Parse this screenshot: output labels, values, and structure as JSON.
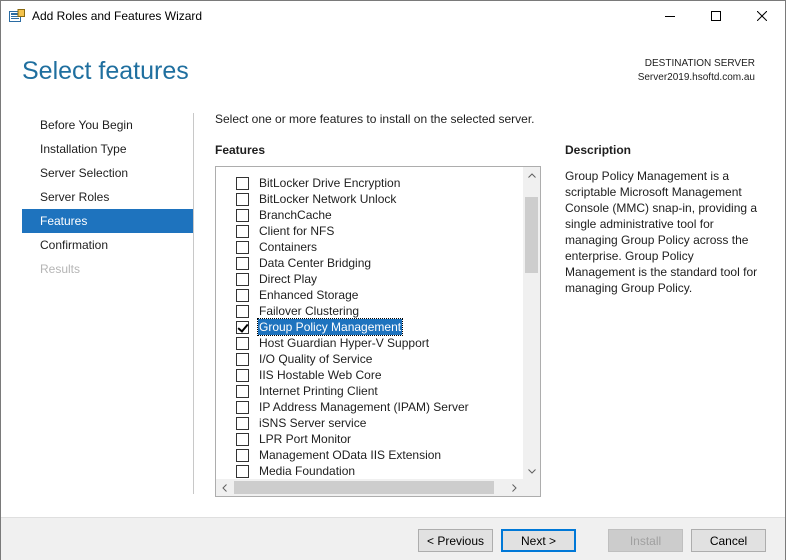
{
  "window": {
    "title": "Add Roles and Features Wizard"
  },
  "header": {
    "page_title": "Select features",
    "destination_label": "DESTINATION SERVER",
    "destination_server": "Server2019.hsoftd.com.au"
  },
  "nav": {
    "items": [
      {
        "label": "Before You Begin",
        "state": "normal"
      },
      {
        "label": "Installation Type",
        "state": "normal"
      },
      {
        "label": "Server Selection",
        "state": "normal"
      },
      {
        "label": "Server Roles",
        "state": "normal"
      },
      {
        "label": "Features",
        "state": "active"
      },
      {
        "label": "Confirmation",
        "state": "normal"
      },
      {
        "label": "Results",
        "state": "disabled"
      }
    ]
  },
  "main": {
    "intro": "Select one or more features to install on the selected server.",
    "features_heading": "Features",
    "description_heading": "Description",
    "description_text": "Group Policy Management is a scriptable Microsoft Management Console (MMC) snap-in, providing a single administrative tool for managing Group Policy across the enterprise. Group Policy Management is the standard tool for managing Group Policy.",
    "features": [
      {
        "label": "BitLocker Drive Encryption",
        "checked": false,
        "selected": false
      },
      {
        "label": "BitLocker Network Unlock",
        "checked": false,
        "selected": false
      },
      {
        "label": "BranchCache",
        "checked": false,
        "selected": false
      },
      {
        "label": "Client for NFS",
        "checked": false,
        "selected": false
      },
      {
        "label": "Containers",
        "checked": false,
        "selected": false
      },
      {
        "label": "Data Center Bridging",
        "checked": false,
        "selected": false
      },
      {
        "label": "Direct Play",
        "checked": false,
        "selected": false
      },
      {
        "label": "Enhanced Storage",
        "checked": false,
        "selected": false
      },
      {
        "label": "Failover Clustering",
        "checked": false,
        "selected": false
      },
      {
        "label": "Group Policy Management",
        "checked": true,
        "selected": true
      },
      {
        "label": "Host Guardian Hyper-V Support",
        "checked": false,
        "selected": false
      },
      {
        "label": "I/O Quality of Service",
        "checked": false,
        "selected": false
      },
      {
        "label": "IIS Hostable Web Core",
        "checked": false,
        "selected": false
      },
      {
        "label": "Internet Printing Client",
        "checked": false,
        "selected": false
      },
      {
        "label": "IP Address Management (IPAM) Server",
        "checked": false,
        "selected": false
      },
      {
        "label": "iSNS Server service",
        "checked": false,
        "selected": false
      },
      {
        "label": "LPR Port Monitor",
        "checked": false,
        "selected": false
      },
      {
        "label": "Management OData IIS Extension",
        "checked": false,
        "selected": false
      },
      {
        "label": "Media Foundation",
        "checked": false,
        "selected": false
      }
    ]
  },
  "footer": {
    "previous_label": "< Previous",
    "next_label": "Next >",
    "install_label": "Install",
    "cancel_label": "Cancel"
  },
  "colors": {
    "accent": "#1e73be",
    "title_blue": "#1f6f9f"
  }
}
